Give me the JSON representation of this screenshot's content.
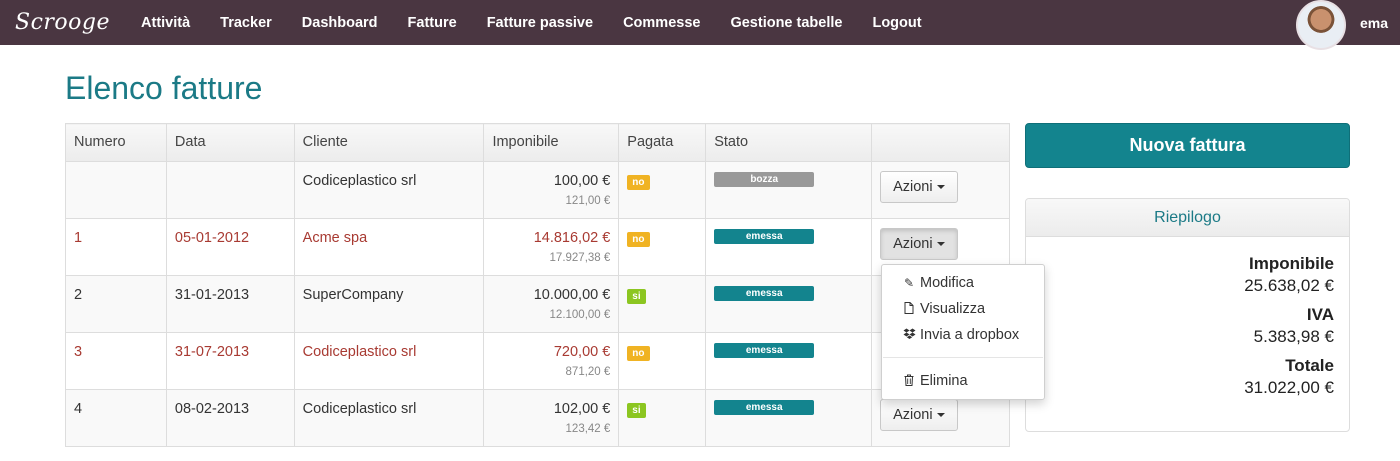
{
  "navbar": {
    "brand": "Scrooge",
    "links": [
      "Attività",
      "Tracker",
      "Dashboard",
      "Fatture",
      "Fatture passive",
      "Commesse",
      "Gestione tabelle",
      "Logout"
    ],
    "user": "ema"
  },
  "page": {
    "title": "Elenco fatture"
  },
  "table": {
    "headers": [
      "Numero",
      "Data",
      "Cliente",
      "Imponibile",
      "Pagata",
      "Stato",
      ""
    ],
    "rows": [
      {
        "numero": "",
        "data": "",
        "cliente": "Codiceplastico srl",
        "imponibile": "100,00 €",
        "totale": "121,00 €",
        "pagata": "no",
        "stato": "bozza",
        "azioni": "Azioni"
      },
      {
        "numero": "1",
        "data": "05-01-2012",
        "cliente": "Acme spa",
        "imponibile": "14.816,02 €",
        "totale": "17.927,38 €",
        "pagata": "no",
        "stato": "emessa",
        "azioni": "Azioni"
      },
      {
        "numero": "2",
        "data": "31-01-2013",
        "cliente": "SuperCompany",
        "imponibile": "10.000,00 €",
        "totale": "12.100,00 €",
        "pagata": "si",
        "stato": "emessa",
        "azioni": "Azioni"
      },
      {
        "numero": "3",
        "data": "31-07-2013",
        "cliente": "Codiceplastico srl",
        "imponibile": "720,00 €",
        "totale": "871,20 €",
        "pagata": "no",
        "stato": "emessa",
        "azioni": "Azioni"
      },
      {
        "numero": "4",
        "data": "08-02-2013",
        "cliente": "Codiceplastico srl",
        "imponibile": "102,00 €",
        "totale": "123,42 €",
        "pagata": "si",
        "stato": "emessa",
        "azioni": "Azioni"
      }
    ]
  },
  "dropdown": {
    "items": [
      {
        "label": "Modifica",
        "icon": "edit-icon"
      },
      {
        "label": "Visualizza",
        "icon": "file-icon"
      },
      {
        "label": "Invia a dropbox",
        "icon": "dropbox-icon"
      },
      {
        "label": "Elimina",
        "icon": "trash-icon"
      }
    ]
  },
  "sidebar": {
    "new_button": "Nuova fattura",
    "summary_title": "Riepilogo",
    "imponibile_label": "Imponibile",
    "imponibile_value": "25.638,02 €",
    "iva_label": "IVA",
    "iva_value": "5.383,98 €",
    "totale_label": "Totale",
    "totale_value": "31.022,00 €"
  },
  "colors": {
    "navbar": "#4a3641",
    "accent": "#13848e",
    "title": "#1b7a86",
    "unpaid_text": "#a83a32",
    "badge_no": "#f0b323",
    "badge_si": "#8cc621",
    "stato_bozza": "#999999"
  }
}
